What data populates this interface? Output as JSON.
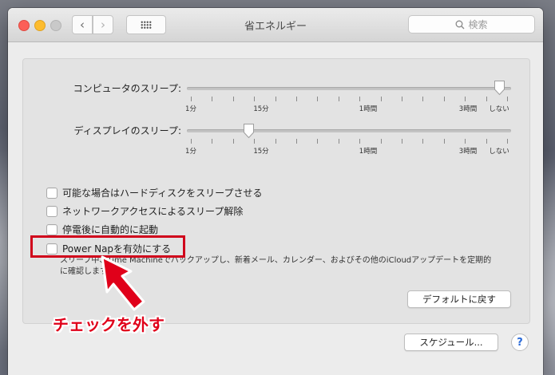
{
  "window": {
    "title": "省エネルギー"
  },
  "search": {
    "placeholder": "検索"
  },
  "sliders": {
    "computer": {
      "label": "コンピュータのスリープ:",
      "value": "しない",
      "ticks": [
        "1分",
        "15分",
        "1時間",
        "3時間",
        "しない"
      ]
    },
    "display": {
      "label": "ディスプレイのスリープ:",
      "value": "15分",
      "ticks": [
        "1分",
        "15分",
        "1時間",
        "3時間",
        "しない"
      ]
    }
  },
  "options": [
    {
      "label": "可能な場合はハードディスクをスリープさせる",
      "checked": false
    },
    {
      "label": "ネットワークアクセスによるスリープ解除",
      "checked": false
    },
    {
      "label": "停電後に自動的に起動",
      "checked": false
    },
    {
      "label": "Power Napを有効にする",
      "checked": false
    }
  ],
  "power_nap_description": {
    "line1": "スリープ中、Time Machineでバックアップし、新着メール、カレンダー、およびその他のiCloudアップデートを定期的",
    "line2": "に確認します"
  },
  "buttons": {
    "defaults": "デフォルトに戻す",
    "schedule": "スケジュール...",
    "help": "?"
  },
  "annotation": {
    "text": "チェックを外す"
  },
  "colors": {
    "annotation": "#e0001a",
    "highlight": "#d0021b"
  }
}
